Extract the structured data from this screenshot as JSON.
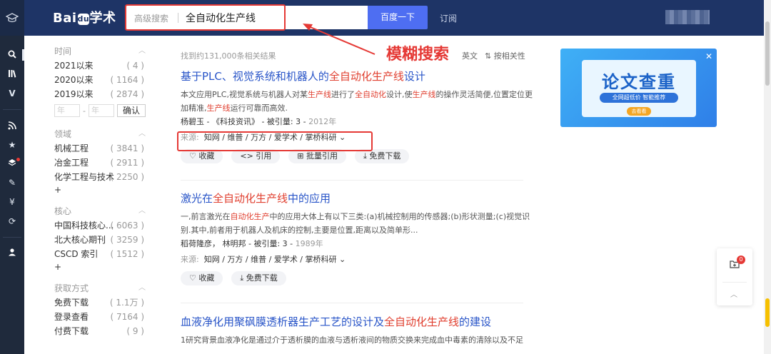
{
  "rail": {
    "icons": [
      "graduation-cap",
      "search",
      "books",
      "v",
      "rss",
      "star",
      "layers",
      "pen",
      "yen",
      "refresh",
      "user"
    ]
  },
  "header": {
    "logo_a": "Bai",
    "logo_paw": "du",
    "logo_b": "学术",
    "advanced_search": "高级搜索",
    "query": "全自动化生产线",
    "search_button": "百度一下",
    "subscribe": "订阅"
  },
  "annotation": {
    "fuzzy_search": "模糊搜索"
  },
  "filters": {
    "time": {
      "label": "时间",
      "items": [
        {
          "label": "2021以来",
          "count": "( 4 )"
        },
        {
          "label": "2020以来",
          "count": "( 1164 )"
        },
        {
          "label": "2019以来",
          "count": "( 2874 )"
        }
      ],
      "year_from_placeholder": "年",
      "dash": "-",
      "year_to_placeholder": "年",
      "confirm": "确认"
    },
    "field": {
      "label": "领域",
      "items": [
        {
          "label": "机械工程",
          "count": "( 3841 )"
        },
        {
          "label": "冶金工程",
          "count": "( 2911 )"
        },
        {
          "label": "化学工程与技术",
          "count": "( 2250 )"
        }
      ],
      "more": "+"
    },
    "core": {
      "label": "核心",
      "items": [
        {
          "label": "中国科技核心...",
          "count": "( 6063 )"
        },
        {
          "label": "北大核心期刊",
          "count": "( 3259 )"
        },
        {
          "label": "CSCD 索引",
          "count": "( 1512 )"
        }
      ],
      "more": "+"
    },
    "access": {
      "label": "获取方式",
      "items": [
        {
          "label": "免费下载",
          "count": "( 1.1万 )"
        },
        {
          "label": "登录查看",
          "count": "( 7164 )"
        },
        {
          "label": "付费下载",
          "count": "( 9 )"
        }
      ]
    }
  },
  "results_header": {
    "count_text": "找到约131,000条相关结果",
    "english": "英文",
    "sort": "按相关性"
  },
  "results": [
    {
      "title_a": "基于PLC、视觉系统和机器人的",
      "title_hl": "全自动化生产线",
      "title_b": "设计",
      "abs_1": "本文应用PLC,视觉系统与机器人对某",
      "abs_hl1": "生产线",
      "abs_2": "进行了",
      "abs_hl2": "全自动化",
      "abs_3": "设计,使",
      "abs_hl3": "生产线",
      "abs_4": "的操作灵活简便,位置定位更加精准,",
      "abs_hl4": "生产线",
      "abs_5": "运行可靠而高效.",
      "meta": "杨碧玉 -  《科技资讯》 -  被引量:  3  - ",
      "year": "2012年",
      "source_label": "来源:",
      "sources": "知网  /  维普  /  万方  /  爱学术  /  掌桥科研  ⌄",
      "buttons": [
        "♡  收藏",
        "<>  引用",
        "⊞  批量引用",
        "⤓  免费下载"
      ]
    },
    {
      "title_a": "激光在",
      "title_hl": "全自动化生产线",
      "title_b": "中的应用",
      "abs_1": "一,前言激光在",
      "abs_hl1": "自动化生产",
      "abs_2": "中的应用大体上有以下三类:(a)机械控制用的传感器;(b)形状测量;(c)视觉识别.其中,前者用于机器人及机床的控制,主要是位置,距离以及简单形...",
      "meta": "稻荷隆彦，  林明邦  -  被引量:  3  - ",
      "year": "1989年",
      "source_label": "来源:",
      "sources": "知网  /  万方  /  维普  /  爱学术  /  掌桥科研  ⌄",
      "buttons": [
        "♡  收藏",
        "⤓  免费下载"
      ]
    },
    {
      "title_a": "血液净化用聚砜膜透析器生产工艺的设计及",
      "title_hl": "全自动化生产线",
      "title_b": "的建设",
      "abs_1": "1研究背景血液净化是通过介于透析膜的血液与透析液间的物质交换来完成血中毒素的清除以及不足"
    }
  ],
  "ad": {
    "title": "论文查重",
    "subtitle": "全网超低价 智能推荐",
    "button": "去看看",
    "close": "✕"
  },
  "float_panel": {
    "badge": "0"
  }
}
